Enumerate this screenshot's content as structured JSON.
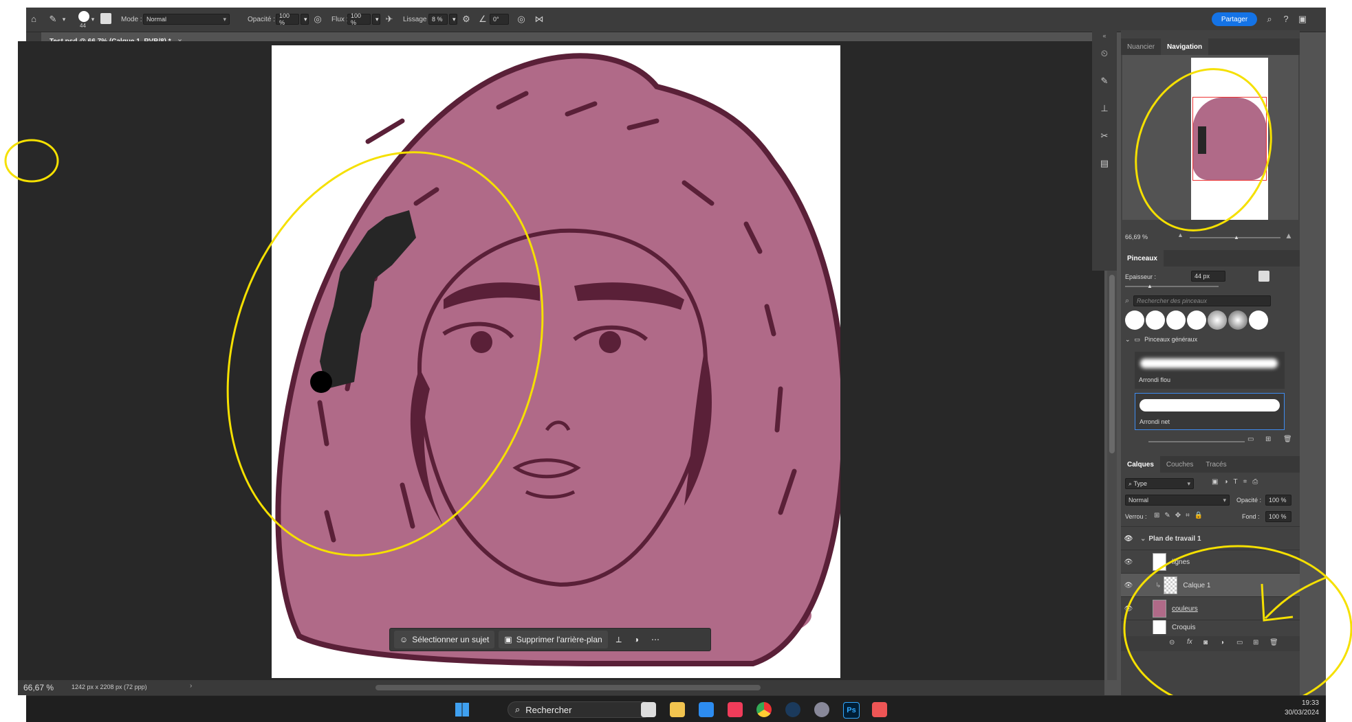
{
  "options_bar": {
    "brush_size": "44",
    "mode_label": "Mode :",
    "mode_value": "Normal",
    "opacity_label": "Opacité :",
    "opacity_value": "100 %",
    "flow_label": "Flux :",
    "flow_value": "100 %",
    "smoothing_label": "Lissage :",
    "smoothing_value": "8 %",
    "angle_value": "0°",
    "share_label": "Partager"
  },
  "document": {
    "tab_title": "Test.psd @ 66,7% (Calque 1, RVB/8) *",
    "zoom": "66,67 %",
    "dimensions": "1242 px x 2208 px (72 ppp)"
  },
  "context_bar": {
    "select_subject": "Sélectionner un sujet",
    "remove_bg": "Supprimer l'arrière-plan"
  },
  "navigator": {
    "tabs": [
      "Nuancier",
      "Navigation"
    ],
    "zoom": "66,69 %"
  },
  "brushes": {
    "title": "Pinceaux",
    "size_label": "Epaisseur :",
    "size_value": "44 px",
    "search_placeholder": "Rechercher des pinceaux",
    "group": "Pinceaux généraux",
    "items": [
      "Arrondi flou",
      "Arrondi net"
    ]
  },
  "layers": {
    "tabs": [
      "Calques",
      "Couches",
      "Tracés"
    ],
    "filter": "Type",
    "blend": "Normal",
    "opacity_label": "Opacité :",
    "opacity_value": "100 %",
    "lock_label": "Verrou :",
    "fill_label": "Fond :",
    "fill_value": "100 %",
    "group": "Plan de travail 1",
    "items": [
      "lignes",
      "Calque 1",
      "couleurs",
      "Croquis"
    ]
  },
  "taskbar": {
    "search": "Rechercher",
    "time": "19:33",
    "date": "30/03/2024"
  },
  "colors": {
    "skin": "#b06a88",
    "line": "#5a2038",
    "annotation": "#f5e000",
    "accent": "#1473e6"
  }
}
